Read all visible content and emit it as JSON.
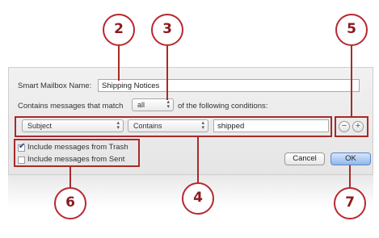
{
  "dialog": {
    "name_label": "Smart Mailbox Name:",
    "name_value": "Shipping Notices",
    "match_prefix": "Contains messages that match",
    "match_option": "all",
    "match_suffix": "of the following conditions:"
  },
  "condition": {
    "field": "Subject",
    "operator": "Contains",
    "value": "shipped",
    "remove_symbol": "−",
    "add_symbol": "+"
  },
  "options": {
    "trash_label": "Include messages from Trash",
    "trash_checked": true,
    "sent_label": "Include messages from Sent",
    "sent_checked": false
  },
  "buttons": {
    "cancel": "Cancel",
    "ok": "OK"
  },
  "callouts": [
    "2",
    "3",
    "5",
    "6",
    "4",
    "7"
  ],
  "colors": {
    "callout_border": "#b8282f",
    "highlight_box": "#a82a2a",
    "ok_button": "#8fb7ee"
  }
}
